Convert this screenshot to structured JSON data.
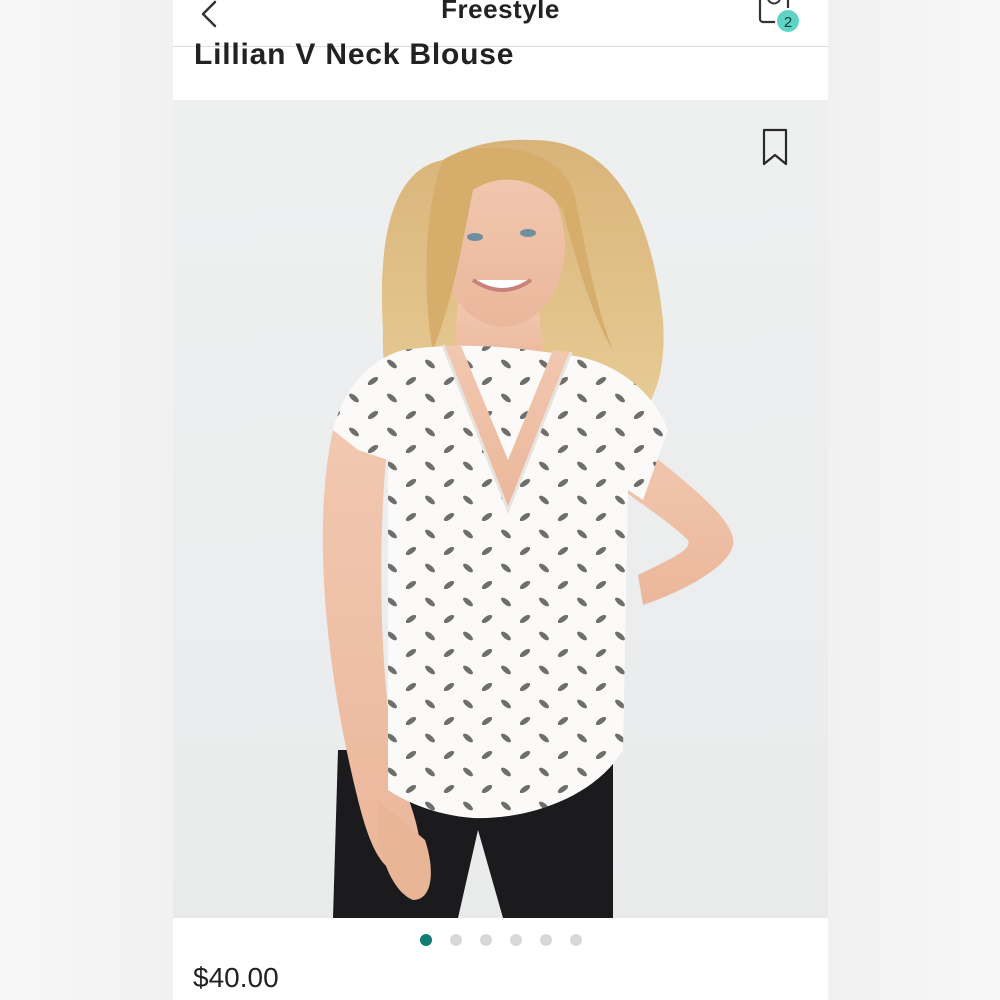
{
  "header": {
    "title": "Freestyle",
    "bag_count": "2"
  },
  "product": {
    "title": "Lillian V Neck Blouse",
    "price": "$40.00",
    "image_count": 6,
    "active_image_index": 0
  },
  "colors": {
    "accent": "#5fd3c4",
    "active_dot": "#127c74",
    "inactive_dot": "#d8d8d8",
    "text": "#222222"
  },
  "icons": {
    "back": "chevron-left-icon",
    "bag": "shopping-bag-icon",
    "save": "bookmark-icon"
  }
}
